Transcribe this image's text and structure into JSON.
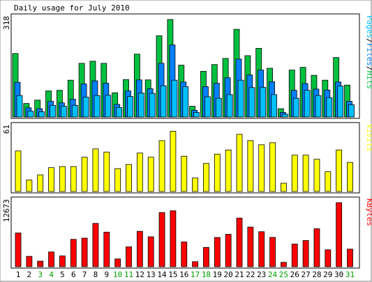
{
  "title": "Daily usage for July 2010",
  "colors": {
    "background": "#ffffff",
    "frame": "#000000",
    "hits": "#00c040",
    "files": "#0080ff",
    "pages": "#00c0ff",
    "visits": "#ffff00",
    "kbytes": "#ff0000",
    "weekday_label": "#000000",
    "weekend_label": "#00a000"
  },
  "chart_data": [
    {
      "type": "bar",
      "title": "Daily usage for July 2010",
      "ylabel": "Pages/Files/Hits",
      "ylabel_parts": [
        "Pages",
        "/",
        "Files",
        "/",
        "Hits"
      ],
      "ymax_label": "318",
      "ylim": [
        0,
        318
      ],
      "categories": [
        "1",
        "2",
        "3",
        "4",
        "5",
        "6",
        "7",
        "8",
        "9",
        "10",
        "11",
        "12",
        "13",
        "14",
        "15",
        "16",
        "17",
        "18",
        "19",
        "20",
        "21",
        "22",
        "23",
        "24",
        "25",
        "26",
        "27",
        "28",
        "29",
        "30",
        "31"
      ],
      "weekend_days": [
        "3",
        "4",
        "10",
        "11",
        "17",
        "18",
        "24",
        "25",
        "31"
      ],
      "series": [
        {
          "name": "Hits",
          "values": [
            207,
            44,
            55,
            85,
            87,
            120,
            175,
            182,
            175,
            79,
            122,
            205,
            121,
            265,
            318,
            169,
            35,
            149,
            171,
            191,
            286,
            200,
            224,
            159,
            27,
            153,
            162,
            136,
            120,
            194,
            104
          ]
        },
        {
          "name": "Files",
          "values": [
            113,
            30,
            27,
            51,
            46,
            58,
            108,
            118,
            110,
            41,
            85,
            121,
            92,
            175,
            235,
            114,
            22,
            99,
            110,
            128,
            189,
            137,
            153,
            115,
            15,
            87,
            109,
            91,
            88,
            114,
            51
          ]
        },
        {
          "name": "Pages",
          "values": [
            70,
            19,
            17,
            38,
            35,
            38,
            65,
            70,
            71,
            31,
            67,
            78,
            77,
            102,
            120,
            99,
            15,
            66,
            61,
            73,
            120,
            96,
            97,
            73,
            9,
            61,
            87,
            70,
            63,
            101,
            40
          ]
        }
      ]
    },
    {
      "type": "bar",
      "ylabel": "Visits",
      "ymax_label": "61",
      "ylim": [
        0,
        61
      ],
      "categories": [
        "1",
        "2",
        "3",
        "4",
        "5",
        "6",
        "7",
        "8",
        "9",
        "10",
        "11",
        "12",
        "13",
        "14",
        "15",
        "16",
        "17",
        "18",
        "19",
        "20",
        "21",
        "22",
        "23",
        "24",
        "25",
        "26",
        "27",
        "28",
        "29",
        "30",
        "31"
      ],
      "series": [
        {
          "name": "Visits",
          "values": [
            39,
            11,
            16,
            23,
            24,
            24,
            33,
            41,
            38,
            22,
            26,
            37,
            33,
            49,
            58,
            34,
            13,
            27,
            36,
            40,
            55,
            49,
            45,
            47,
            8,
            35,
            35,
            31,
            19,
            40,
            28
          ]
        }
      ]
    },
    {
      "type": "bar",
      "ylabel": "KBytes",
      "ymax_label": "12673",
      "ylim": [
        0,
        12673
      ],
      "categories": [
        "1",
        "2",
        "3",
        "4",
        "5",
        "6",
        "7",
        "8",
        "9",
        "10",
        "11",
        "12",
        "13",
        "14",
        "15",
        "16",
        "17",
        "18",
        "19",
        "20",
        "21",
        "22",
        "23",
        "24",
        "25",
        "26",
        "27",
        "28",
        "29",
        "30",
        "31"
      ],
      "series": [
        {
          "name": "KBytes",
          "values": [
            6670,
            2050,
            1100,
            2920,
            2130,
            5410,
            5650,
            8570,
            6840,
            1540,
            3930,
            7000,
            5920,
            10720,
            11060,
            4900,
            1000,
            3820,
            5780,
            6410,
            9620,
            7840,
            6920,
            5800,
            860,
            4480,
            5180,
            7510,
            3340,
            12673,
            3480
          ]
        }
      ]
    }
  ]
}
